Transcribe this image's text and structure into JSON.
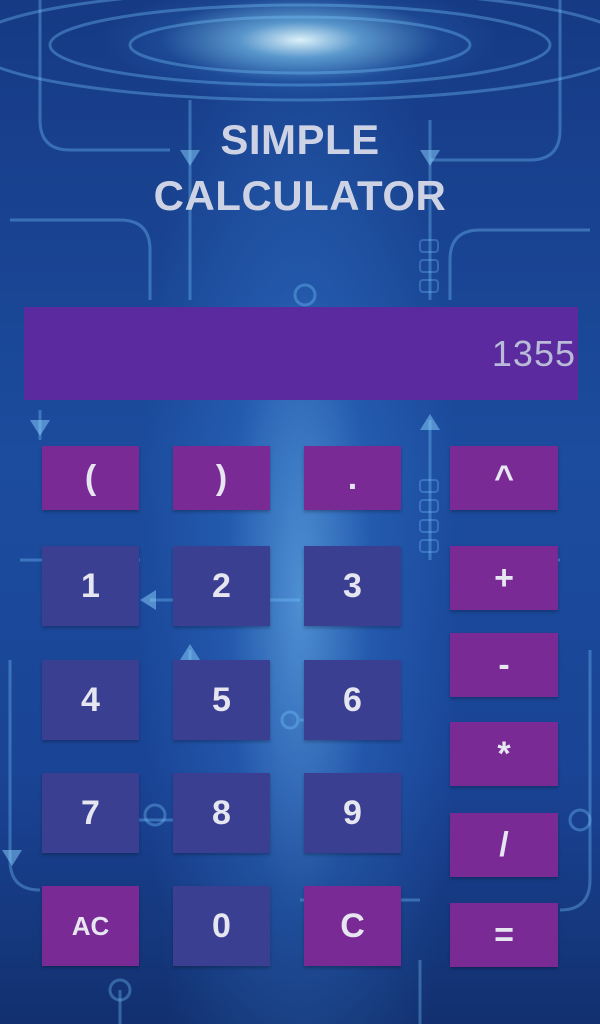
{
  "app": {
    "title": "SIMPLE\nCALCULATOR"
  },
  "display": {
    "value": "1355"
  },
  "keys": {
    "lparen": "(",
    "rparen": ")",
    "dot": ".",
    "pow": "^",
    "one": "1",
    "two": "2",
    "three": "3",
    "plus": "+",
    "four": "4",
    "five": "5",
    "six": "6",
    "minus": "-",
    "star": "*",
    "seven": "7",
    "eight": "8",
    "nine": "9",
    "slash": "/",
    "ac": "AC",
    "zero": "0",
    "clear": "C",
    "equals": "="
  },
  "colors": {
    "display_bg": "#5a2a9e",
    "operator_bg": "#7a2a95",
    "number_bg": "#3b3f92",
    "text": "#e6e6f0"
  }
}
